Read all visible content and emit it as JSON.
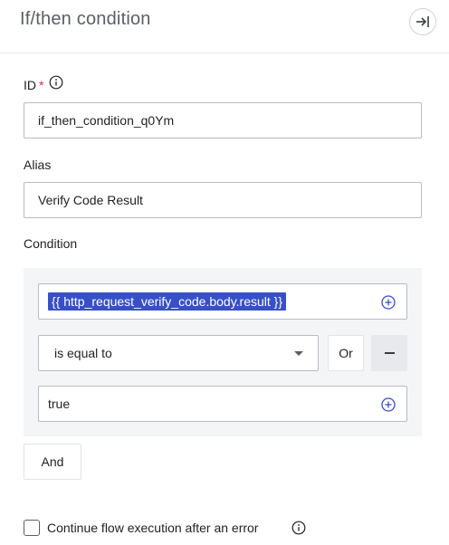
{
  "header": {
    "title": "If/then condition"
  },
  "form": {
    "id_label": "ID",
    "id_required_mark": "*",
    "id_value": "if_then_condition_q0Ym",
    "alias_label": "Alias",
    "alias_value": "Verify Code Result",
    "condition_label": "Condition"
  },
  "condition": {
    "left_operand": "{{ http_request_verify_code.body.result }}",
    "operator": "is equal to",
    "or_label": "Or",
    "right_operand": "true",
    "and_label": "And"
  },
  "footer": {
    "continue_on_error_label": "Continue flow execution after an error",
    "continue_on_error_checked": false
  },
  "colors": {
    "accent": "#3750c8",
    "required": "#d1334b",
    "panel_bg": "#f4f5f7"
  },
  "icons": {
    "collapse": "collapse-panel-icon",
    "info": "info-icon",
    "add": "plus-circle-icon",
    "dropdown": "caret-down-icon",
    "remove": "minus-icon"
  }
}
